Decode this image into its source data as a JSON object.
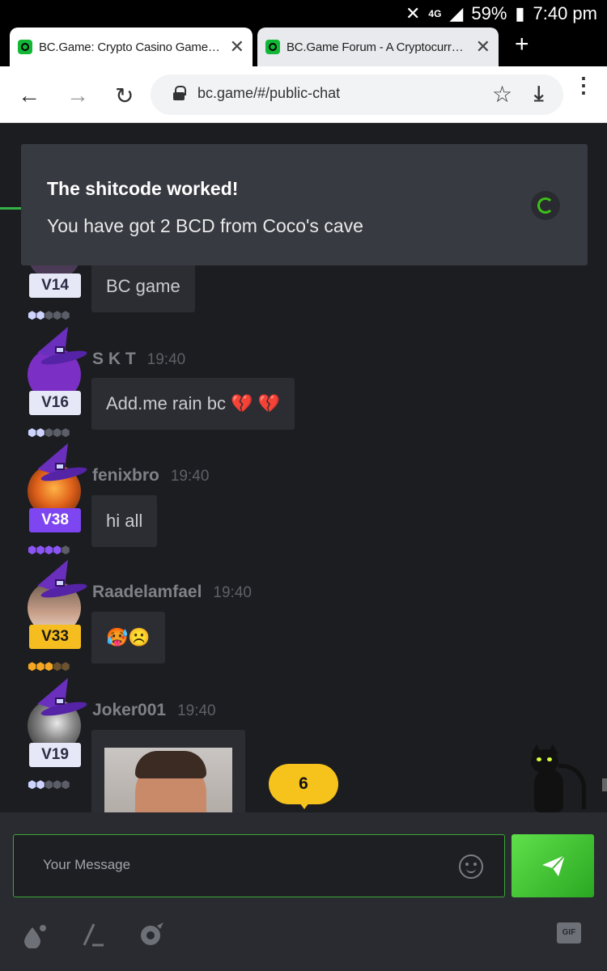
{
  "status_bar": {
    "network": "4G",
    "battery": "59%",
    "time": "7:40 pm"
  },
  "tabs": [
    {
      "title": "BC.Game: Crypto Casino Games & ",
      "active": true
    },
    {
      "title": "BC.Game Forum - A Cryptocurrenc",
      "active": false
    }
  ],
  "browser": {
    "url": "bc.game/#/public-chat"
  },
  "toast": {
    "title": "The shitcode worked!",
    "message": "You have got 2 BCD from Coco's cave"
  },
  "messages": [
    {
      "vip": "V14",
      "text": "BC game"
    },
    {
      "user": "S K T",
      "time": "19:40",
      "vip": "V16",
      "text": "Add.me rain bc",
      "emoji": "💔 💔"
    },
    {
      "user": "fenixbro",
      "time": "19:40",
      "vip": "V38",
      "text": "hi all"
    },
    {
      "user": "Raadelamfael",
      "time": "19:40",
      "vip": "V33",
      "text": "🥵☹️"
    },
    {
      "user": "Joker001",
      "time": "19:40",
      "vip": "V19"
    }
  ],
  "unread_count": "6",
  "composer": {
    "placeholder": "Your Message",
    "gif_label": "GIF"
  },
  "colors": {
    "accent_green": "#3bc117",
    "vip_purple": "#7d46f0",
    "vip_gold": "#f5bd1f",
    "badge_yellow": "#f6c21c"
  }
}
